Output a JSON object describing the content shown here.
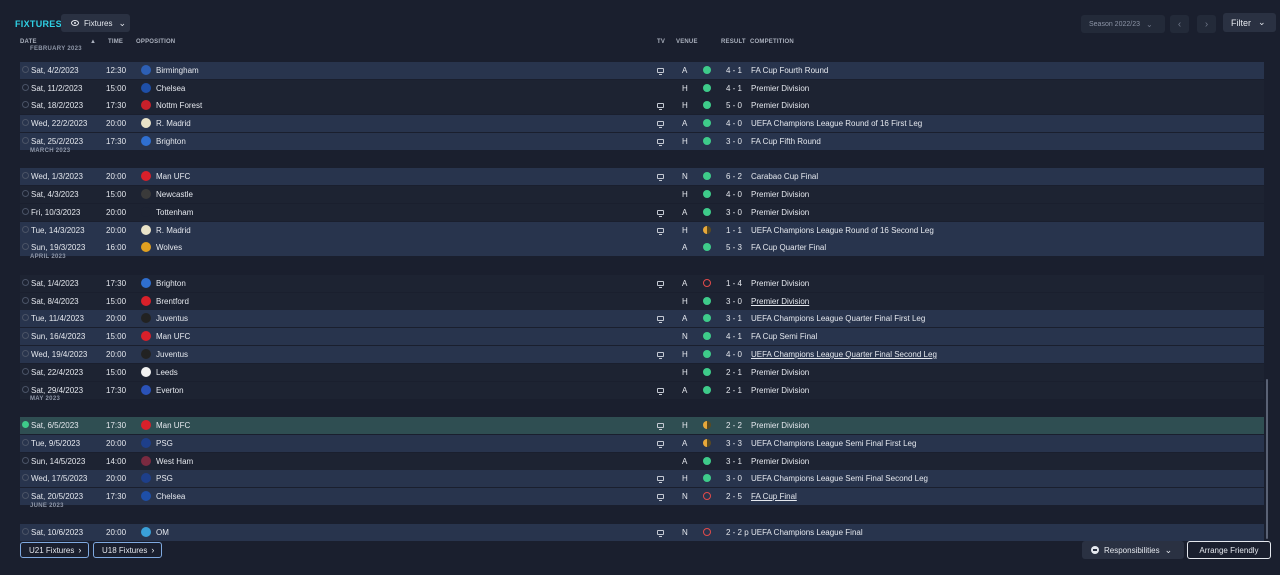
{
  "header": {
    "title": "FIXTURES",
    "view_label": "Fixtures",
    "season_label": "Season 2022/23",
    "filter_label": "Filter"
  },
  "columns": {
    "date": "DATE",
    "time": "TIME",
    "opposition": "OPPOSITION",
    "tv": "TV",
    "venue": "VENUE",
    "result": "RESULT",
    "competition": "COMPETITION"
  },
  "months": [
    "FEBRUARY 2023",
    "MARCH 2023",
    "APRIL 2023",
    "MAY 2023",
    "JUNE 2023"
  ],
  "fixtures": [
    {
      "date": "Sat, 4/2/2023",
      "time": "12:30",
      "team": "Birmingham",
      "tv": true,
      "venue": "A",
      "result": "win",
      "score": "4 - 1",
      "competition": "FA Cup Fourth Round",
      "crest": "#2d5fb4"
    },
    {
      "date": "Sat, 11/2/2023",
      "time": "15:00",
      "team": "Chelsea",
      "tv": false,
      "venue": "H",
      "result": "win",
      "score": "4 - 1",
      "competition": "Premier Division",
      "crest": "#1e4fa8"
    },
    {
      "date": "Sat, 18/2/2023",
      "time": "17:30",
      "team": "Nottm Forest",
      "tv": true,
      "venue": "H",
      "result": "win",
      "score": "5 - 0",
      "competition": "Premier Division",
      "crest": "#c8202a"
    },
    {
      "date": "Wed, 22/2/2023",
      "time": "20:00",
      "team": "R. Madrid",
      "tv": true,
      "venue": "A",
      "result": "win",
      "score": "4 - 0",
      "competition": "UEFA Champions League Round of 16 First Leg",
      "crest": "#e9e3c8"
    },
    {
      "date": "Sat, 25/2/2023",
      "time": "17:30",
      "team": "Brighton",
      "tv": true,
      "venue": "H",
      "result": "win",
      "score": "3 - 0",
      "competition": "FA Cup Fifth Round",
      "crest": "#2f6fd0"
    },
    {
      "date": "Wed, 1/3/2023",
      "time": "20:00",
      "team": "Man UFC",
      "tv": true,
      "venue": "N",
      "result": "win",
      "score": "6 - 2",
      "competition": "Carabao Cup Final",
      "crest": "#d8202a"
    },
    {
      "date": "Sat, 4/3/2023",
      "time": "15:00",
      "team": "Newcastle",
      "tv": false,
      "venue": "H",
      "result": "win",
      "score": "4 - 0",
      "competition": "Premier Division",
      "crest": "#3a3a3a"
    },
    {
      "date": "Fri, 10/3/2023",
      "time": "20:00",
      "team": "Tottenham",
      "tv": true,
      "venue": "A",
      "result": "win",
      "score": "3 - 0",
      "competition": "Premier Division",
      "crest": "#1d2332"
    },
    {
      "date": "Tue, 14/3/2023",
      "time": "20:00",
      "team": "R. Madrid",
      "tv": true,
      "venue": "H",
      "result": "draw",
      "score": "1 - 1",
      "competition": "UEFA Champions League Round of 16  Second Leg",
      "crest": "#e9e3c8"
    },
    {
      "date": "Sun, 19/3/2023",
      "time": "16:00",
      "team": "Wolves",
      "tv": false,
      "venue": "A",
      "result": "win",
      "score": "5 - 3",
      "competition": "FA Cup Quarter Final",
      "crest": "#e0a020"
    },
    {
      "date": "Sat, 1/4/2023",
      "time": "17:30",
      "team": "Brighton",
      "tv": true,
      "venue": "A",
      "result": "loss",
      "score": "1 - 4",
      "competition": "Premier Division",
      "crest": "#2f6fd0"
    },
    {
      "date": "Sat, 8/4/2023",
      "time": "15:00",
      "team": "Brentford",
      "tv": false,
      "venue": "H",
      "result": "win",
      "score": "3 - 0",
      "competition": "Premier Division",
      "crest": "#d8202a",
      "underline": true
    },
    {
      "date": "Tue, 11/4/2023",
      "time": "20:00",
      "team": "Juventus",
      "tv": true,
      "venue": "A",
      "result": "win",
      "score": "3 - 1",
      "competition": "UEFA Champions League Quarter Final First Leg",
      "crest": "#222222"
    },
    {
      "date": "Sun, 16/4/2023",
      "time": "15:00",
      "team": "Man UFC",
      "tv": false,
      "venue": "N",
      "result": "win",
      "score": "4 - 1",
      "competition": "FA Cup Semi Final",
      "crest": "#d8202a"
    },
    {
      "date": "Wed, 19/4/2023",
      "time": "20:00",
      "team": "Juventus",
      "tv": true,
      "venue": "H",
      "result": "win",
      "score": "4 - 0",
      "competition": "UEFA Champions League Quarter Final Second Leg",
      "crest": "#222222",
      "underline": true
    },
    {
      "date": "Sat, 22/4/2023",
      "time": "15:00",
      "team": "Leeds",
      "tv": false,
      "venue": "H",
      "result": "win",
      "score": "2 - 1",
      "competition": "Premier Division",
      "crest": "#f2f2f2"
    },
    {
      "date": "Sat, 29/4/2023",
      "time": "17:30",
      "team": "Everton",
      "tv": true,
      "venue": "A",
      "result": "win",
      "score": "2 - 1",
      "competition": "Premier Division",
      "crest": "#2a52b8"
    },
    {
      "date": "Sat, 6/5/2023",
      "time": "17:30",
      "team": "Man UFC",
      "tv": true,
      "venue": "H",
      "result": "draw",
      "score": "2 - 2",
      "competition": "Premier Division",
      "crest": "#d8202a",
      "checked": true
    },
    {
      "date": "Tue, 9/5/2023",
      "time": "20:00",
      "team": "PSG",
      "tv": true,
      "venue": "A",
      "result": "draw",
      "score": "3 - 3",
      "competition": "UEFA Champions League Semi Final First Leg",
      "crest": "#1e3f8a"
    },
    {
      "date": "Sun, 14/5/2023",
      "time": "14:00",
      "team": "West Ham",
      "tv": false,
      "venue": "A",
      "result": "win",
      "score": "3 - 1",
      "competition": "Premier Division",
      "crest": "#7a2a40"
    },
    {
      "date": "Wed, 17/5/2023",
      "time": "20:00",
      "team": "PSG",
      "tv": true,
      "venue": "H",
      "result": "win",
      "score": "3 - 0",
      "competition": "UEFA Champions League Semi Final Second Leg",
      "crest": "#1e3f8a"
    },
    {
      "date": "Sat, 20/5/2023",
      "time": "17:30",
      "team": "Chelsea",
      "tv": true,
      "venue": "N",
      "result": "loss",
      "score": "2 - 5",
      "competition": "FA Cup Final",
      "crest": "#1e4fa8",
      "underline": true
    },
    {
      "date": "Sat, 10/6/2023",
      "time": "20:00",
      "team": "OM",
      "tv": true,
      "venue": "N",
      "result": "loss",
      "score": "2 - 2 p",
      "competition": "UEFA Champions League Final",
      "crest": "#3aa0d8"
    }
  ],
  "footer": {
    "u21_label": "U21 Fixtures",
    "u18_label": "U18 Fixtures",
    "responsibilities_label": "Responsibilities",
    "arrange_label": "Arrange Friendly"
  }
}
